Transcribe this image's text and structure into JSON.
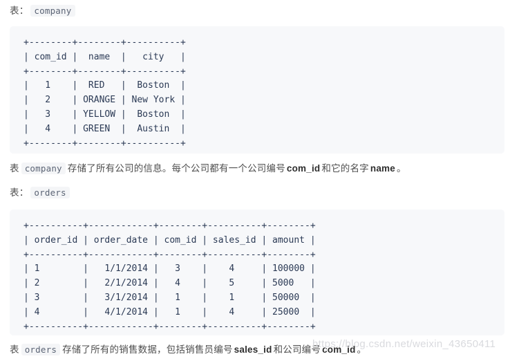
{
  "document": {
    "company_section": {
      "label_prefix": "表：",
      "table_name": "company"
    },
    "company_table": {
      "type": "table",
      "columns": [
        "com_id",
        "name",
        "city"
      ],
      "rows": [
        [
          "1",
          "RED",
          "Boston"
        ],
        [
          "2",
          "ORANGE",
          "New York"
        ],
        [
          "3",
          "YELLOW",
          "Boston"
        ],
        [
          "4",
          "GREEN",
          "Austin"
        ]
      ],
      "ascii": "+--------+--------+----------+\n| com_id |  name  |   city   |\n+--------+--------+----------+\n|   1    |  RED   |  Boston  |\n|   2    | ORANGE | New York |\n|   3    | YELLOW |  Boston  |\n|   4    | GREEN  |  Austin  |\n+--------+--------+----------+"
    },
    "company_description": {
      "part1": "表",
      "code1": "company",
      "part2": "存储了所有公司的信息。每个公司都有一个公司编号",
      "bold1": "com_id",
      "part3": "和它的名字",
      "bold2": "name",
      "part4": "。"
    },
    "orders_section": {
      "label_prefix": "表：",
      "table_name": "orders"
    },
    "orders_table": {
      "type": "table",
      "columns": [
        "order_id",
        "order_date",
        "com_id",
        "sales_id",
        "amount"
      ],
      "rows": [
        [
          "1",
          "1/1/2014",
          "3",
          "4",
          "100000"
        ],
        [
          "2",
          "2/1/2014",
          "4",
          "5",
          "5000"
        ],
        [
          "3",
          "3/1/2014",
          "1",
          "1",
          "50000"
        ],
        [
          "4",
          "4/1/2014",
          "1",
          "4",
          "25000"
        ]
      ],
      "ascii": "+----------+------------+--------+----------+--------+\n| order_id | order_date | com_id | sales_id | amount |\n+----------+------------+--------+----------+--------+\n| 1        |   1/1/2014 |   3    |    4     | 100000 |\n| 2        |   2/1/2014 |   4    |    5     | 5000   |\n| 3        |   3/1/2014 |   1    |    1     | 50000  |\n| 4        |   4/1/2014 |   1    |    4     | 25000  |\n+----------+------------+--------+----------+--------+"
    },
    "orders_description": {
      "part1": "表",
      "code1": "orders",
      "part2": "存储了所有的销售数据，包括销售员编号",
      "bold1": "sales_id",
      "part3": "和公司编号",
      "bold2": "com_id",
      "part4": "。"
    },
    "watermark": {
      "text": "https://blog.csdn.net/weixin_43650411"
    },
    "colors": {
      "code_block_background": "#f7f8fa",
      "code_text": "#2b3a55",
      "inline_chip_background": "#f4f5f7",
      "inline_chip_text": "#5b6475",
      "body_text": "#4f4f4f",
      "watermark": "#d9dade"
    }
  }
}
